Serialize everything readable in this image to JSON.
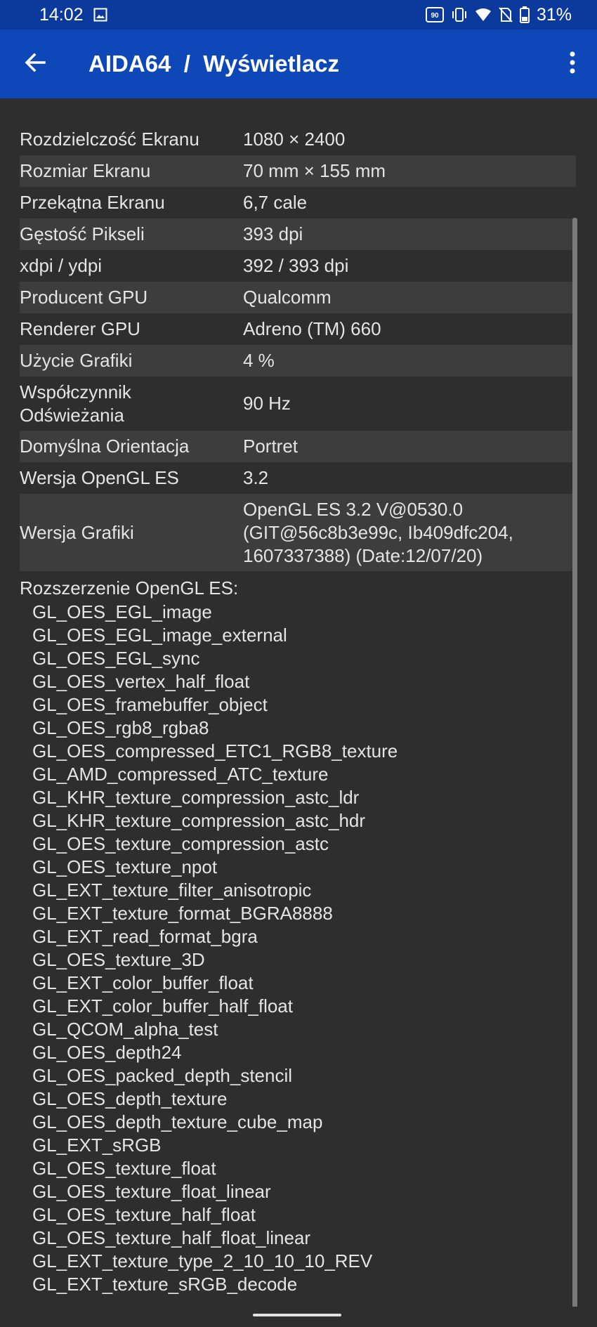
{
  "status_bar": {
    "time": "14:02",
    "refresh_badge": "90",
    "battery": "31%"
  },
  "toolbar": {
    "title": "AIDA64  /  Wyświetlacz"
  },
  "properties": [
    {
      "label": "Rozdzielczość Ekranu",
      "value": "1080 × 2400"
    },
    {
      "label": "Rozmiar Ekranu",
      "value": "70 mm × 155 mm"
    },
    {
      "label": "Przekątna Ekranu",
      "value": "6,7 cale"
    },
    {
      "label": "Gęstość Pikseli",
      "value": "393 dpi"
    },
    {
      "label": "xdpi / ydpi",
      "value": "392 / 393 dpi"
    },
    {
      "label": "Producent GPU",
      "value": "Qualcomm"
    },
    {
      "label": "Renderer GPU",
      "value": "Adreno (TM) 660"
    },
    {
      "label": "Użycie Grafiki",
      "value": "4 %"
    },
    {
      "label": "Współczynnik\nOdświeżania",
      "value": "90 Hz"
    },
    {
      "label": "Domyślna Orientacja",
      "value": "Portret"
    },
    {
      "label": "Wersja OpenGL ES",
      "value": "3.2"
    },
    {
      "label": "Wersja Grafiki",
      "value": "OpenGL ES 3.2 V@0530.0\n(GIT@56c8b3e99c, Ib409dfc204,\n1607337388) (Date:12/07/20)"
    }
  ],
  "extensions": {
    "title": "Rozszerzenie OpenGL ES:",
    "items": [
      "GL_OES_EGL_image",
      "GL_OES_EGL_image_external",
      "GL_OES_EGL_sync",
      "GL_OES_vertex_half_float",
      "GL_OES_framebuffer_object",
      "GL_OES_rgb8_rgba8",
      "GL_OES_compressed_ETC1_RGB8_texture",
      "GL_AMD_compressed_ATC_texture",
      "GL_KHR_texture_compression_astc_ldr",
      "GL_KHR_texture_compression_astc_hdr",
      "GL_OES_texture_compression_astc",
      "GL_OES_texture_npot",
      "GL_EXT_texture_filter_anisotropic",
      "GL_EXT_texture_format_BGRA8888",
      "GL_EXT_read_format_bgra",
      "GL_OES_texture_3D",
      "GL_EXT_color_buffer_float",
      "GL_EXT_color_buffer_half_float",
      "GL_QCOM_alpha_test",
      "GL_OES_depth24",
      "GL_OES_packed_depth_stencil",
      "GL_OES_depth_texture",
      "GL_OES_depth_texture_cube_map",
      "GL_EXT_sRGB",
      "GL_OES_texture_float",
      "GL_OES_texture_float_linear",
      "GL_OES_texture_half_float",
      "GL_OES_texture_half_float_linear",
      "GL_EXT_texture_type_2_10_10_10_REV",
      "GL_EXT_texture_sRGB_decode"
    ]
  },
  "icons": {
    "back": "arrow-back-icon",
    "menu": "more-vert-icon",
    "gallery": "image-icon",
    "vibrate": "vibrate-icon",
    "wifi": "wifi-icon",
    "no_sim": "no-sim-icon",
    "battery": "battery-icon"
  },
  "colors": {
    "toolbar": "#0d47b8",
    "status_bar": "#0b3a9c",
    "background": "#2e2e2e",
    "row_alt": "#3d3d3d",
    "text": "#e4e4e4"
  }
}
